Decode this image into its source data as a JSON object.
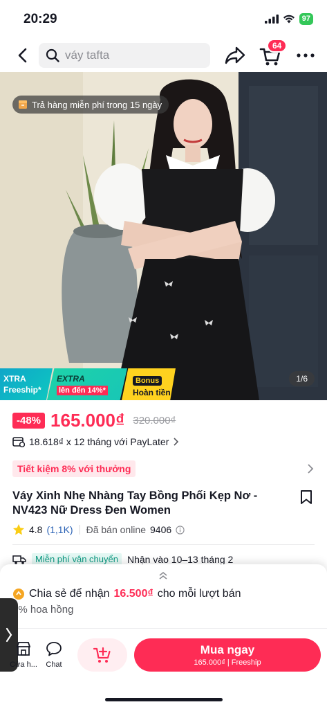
{
  "status_bar": {
    "time": "20:29",
    "battery": "97"
  },
  "header": {
    "search_placeholder": "váy tafta",
    "cart_count": "64"
  },
  "hero": {
    "return_policy": "Trả hàng miễn phí trong 15 ngày",
    "image_counter": "1/6",
    "promos": {
      "xtra_line1": "XTRA",
      "xtra_line2": "Freeship*",
      "extra_line1": "EXTRA",
      "extra_line2": "lên đến 14%*",
      "bonus_line1": "Bonus",
      "bonus_line2": "Hoàn tiền"
    }
  },
  "product": {
    "discount": "-48%",
    "price": "165.000₫",
    "old_price": "320.000₫",
    "paylater": "18.618₫ x 12 tháng với PayLater",
    "save_tag": "Tiết kiệm 8% với thưởng",
    "title": "Váy Xinh Nhẹ Nhàng Tay Bồng Phối Kẹp Nơ - NV423 Nữ Dress Đen Women",
    "rating": "4.8",
    "rating_count": "(1,1K)",
    "sold_label": "Đã bán online",
    "sold_count": "9406",
    "freeship_tag": "Miễn phí vận chuyển",
    "delivery": "Nhận vào 10–13 tháng 2"
  },
  "sheet": {
    "share_prefix": "Chia sẻ để nhận",
    "share_amount": "16.500₫",
    "share_suffix": "cho mỗi lượt bán",
    "commission": "0% hoa hồng"
  },
  "bottom_bar": {
    "shop_label": "Cửa h...",
    "chat_label": "Chat",
    "buy_label": "Mua ngay",
    "buy_sub": "165.000₫ | Freeship"
  },
  "colors": {
    "brand": "#fe2c55",
    "teal": "#0ec8c0",
    "yellow": "#ffd21f"
  }
}
